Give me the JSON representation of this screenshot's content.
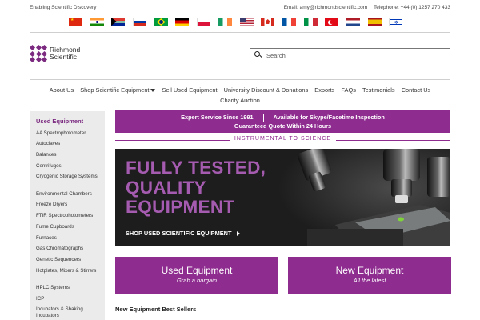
{
  "header": {
    "tagline": "Enabling Scientific Discovery",
    "email": "Email: amy@richmondscientific.com",
    "phone": "Telephone: +44 (0) 1257 270 433"
  },
  "flags": [
    "china-flag-icon",
    "india-flag-icon",
    "south-africa-flag-icon",
    "russia-flag-icon",
    "brazil-flag-icon",
    "germany-flag-icon",
    "poland-flag-icon",
    "ireland-flag-icon",
    "usa-flag-icon",
    "canada-flag-icon",
    "france-flag-icon",
    "italy-flag-icon",
    "turkey-flag-icon",
    "netherlands-flag-icon",
    "spain-flag-icon",
    "israel-flag-icon"
  ],
  "logo": {
    "line1": "Richmond",
    "line2": "Scientific"
  },
  "search": {
    "placeholder": "Search"
  },
  "nav": {
    "items": [
      "About Us",
      "Shop Scientific Equipment",
      "Sell Used Equipment",
      "University Discount & Donations",
      "Exports",
      "FAQs",
      "Testimonials",
      "Contact Us",
      "Charity Auction"
    ]
  },
  "sidebar": {
    "title": "Used Equipment",
    "items": [
      "AA Spectrophotometer",
      "Autoclaves",
      "Balances",
      "Centrifuges",
      "Cryogenic Storage Systems",
      "Environmental Chambers",
      "Freeze Dryers",
      "FTIR Spectrophotometers",
      "Fume Cupboards",
      "Furnaces",
      "Gas Chromatographs",
      "Genetic Sequencers",
      "Hotplates, Mixers & Stirrers",
      "HPLC Systems",
      "ICP",
      "Incubators & Shaking Incubators"
    ]
  },
  "promo": {
    "service": "Expert Service Since 1991",
    "skype": "Available for Skype/Facetime Inspection",
    "quote": "Guaranteed Quote Within 24 Hours"
  },
  "tagbar": {
    "text": "INSTRUMENTAL TO SCIENCE"
  },
  "hero": {
    "title_1": "FULLY TESTED,",
    "title_2": "QUALITY",
    "title_3": "EQUIPMENT",
    "cta": "SHOP USED SCIENTIFIC EQUIPMENT"
  },
  "cards": {
    "used_title": "Used Equipment",
    "used_sub": "Grab a bargain",
    "new_title": "New Equipment",
    "new_sub": "All the latest"
  },
  "bestsellers": {
    "heading": "New Equipment Best Sellers"
  },
  "colors": {
    "brand": "#8e2c8f",
    "hero_text": "#a55bb0",
    "hero_bg": "#1e1d1d"
  }
}
